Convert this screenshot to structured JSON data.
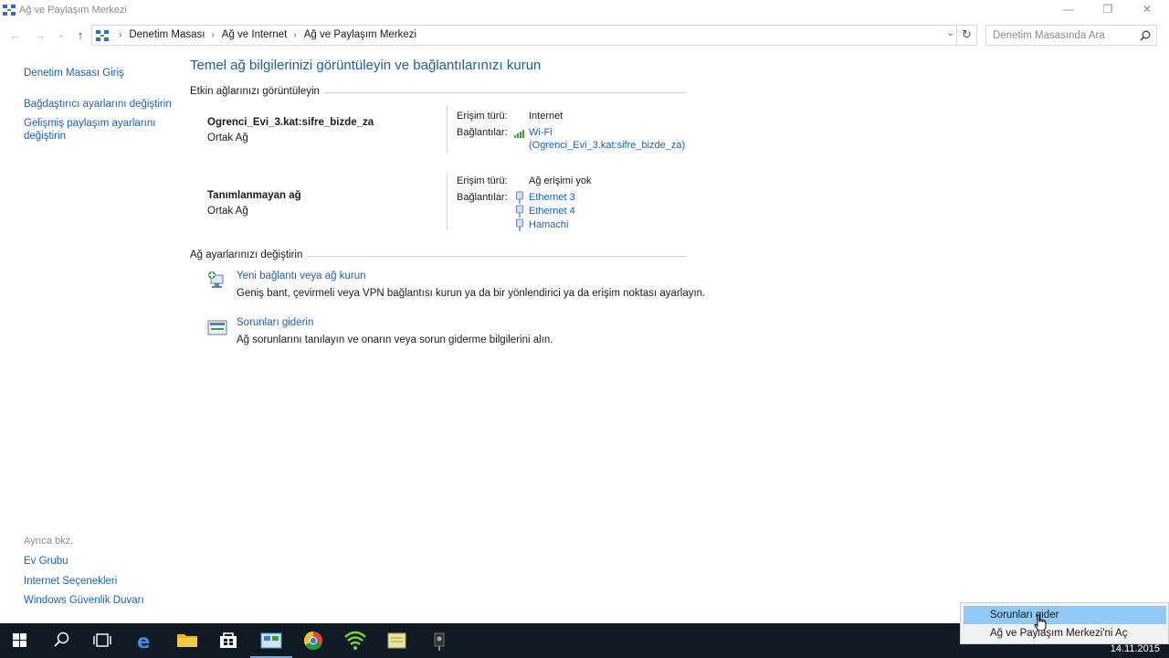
{
  "window": {
    "title": "Ağ ve Paylaşım Merkezi"
  },
  "titlebar_buttons": {
    "minimize": "—",
    "maximize": "❐",
    "close": "✕"
  },
  "nav": {
    "back": "←",
    "forward": "→",
    "recent": "⌄",
    "up": "↑",
    "dropdown": "⌄",
    "refresh": "↻"
  },
  "address": {
    "crumbs": [
      "Denetim Masası",
      "Ağ ve Internet",
      "Ağ ve Paylaşım Merkezi"
    ],
    "separator": "›"
  },
  "search": {
    "placeholder": "Denetim Masasında Ara"
  },
  "sidebar": {
    "items": [
      "Denetim Masası Giriş",
      "Bağdaştırıcı ayarlarını değiştirin",
      "Gelişmiş paylaşım ayarlarını değiştirin"
    ],
    "see_also": "Ayrıca bkz.",
    "see_also_items": [
      "Ev Grubu",
      "Internet Seçenekleri",
      "Windows Güvenlik Duvarı"
    ]
  },
  "main": {
    "heading": "Temel ağ bilgilerinizi görüntüleyin ve bağlantılarınızı kurun",
    "active_section": "Etkin ağlarınızı görüntüleyin",
    "networks": [
      {
        "name": "Ogrenci_Evi_3.kat:sifre_bizde_za",
        "type": "Ortak Ağ",
        "access_label": "Erişim türü:",
        "access": "Internet",
        "connections_label": "Bağlantılar:",
        "connections": [
          "Wi-Fi",
          "(Ogrenci_Evi_3.kat:sifre_bizde_za)"
        ]
      },
      {
        "name": "Tanımlanmayan ağ",
        "type": "Ortak Ağ",
        "access_label": "Erişim türü:",
        "access": "Ağ erişimi yok",
        "connections_label": "Bağlantılar:",
        "connections": [
          "Ethernet 3",
          "Ethernet 4",
          "Hamachi"
        ]
      }
    ],
    "change_section": "Ağ ayarlarınızı değiştirin",
    "tasks": [
      {
        "link": "Yeni bağlantı veya ağ kurun",
        "desc": "Geniş bant, çevirmeli veya VPN bağlantısı kurun ya da bir yönlendirici ya da erişim noktası ayarlayın."
      },
      {
        "link": "Sorunları giderin",
        "desc": "Ağ sorunlarını tanılayın ve onarın veya sorun giderme bilgilerini alın."
      }
    ]
  },
  "context_menu": {
    "items": [
      "Sorunları gider",
      "Ağ ve Paylaşım Merkezi'ni Aç"
    ]
  },
  "taskbar": {
    "icons": [
      "windows-start-icon",
      "search-icon",
      "task-view-icon",
      "edge-icon",
      "file-explorer-icon",
      "store-icon",
      "control-panel-icon",
      "chrome-icon",
      "wifi-app-icon",
      "notes-icon",
      "media-icon"
    ],
    "clock": "14.11.2015"
  },
  "colors": {
    "link": "#1a5fb4",
    "heading": "#1f5c9c",
    "taskbar": "#101a24",
    "menu_highlight": "#91c9f7"
  }
}
